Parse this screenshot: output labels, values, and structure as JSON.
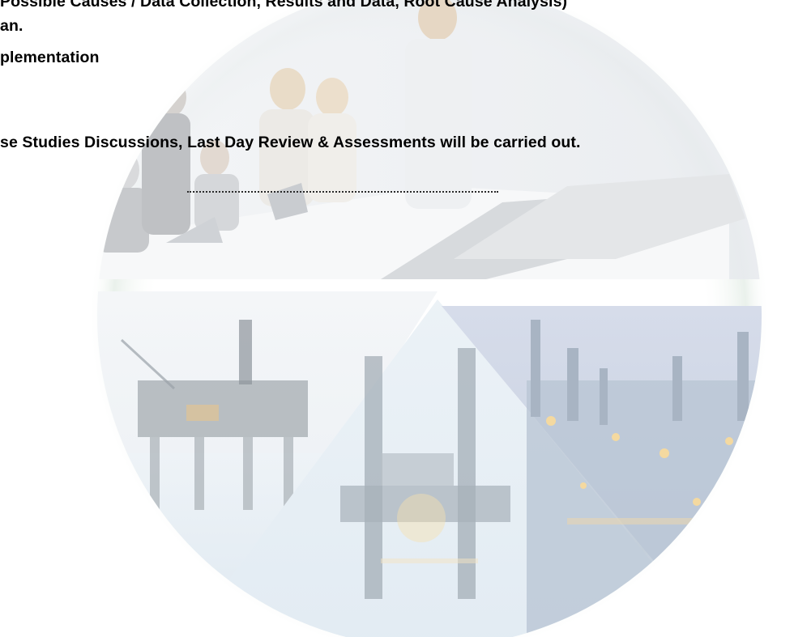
{
  "document": {
    "lines": [
      "Possible Causes / Data Collection, Results and Data, Root Cause Analysis)",
      "an.",
      "plementation",
      "se Studies Discussions, Last Day Review & Assessments will be carried out."
    ]
  },
  "background": {
    "top_image": "business-meeting-photo",
    "bottom_images": [
      "offshore-platform-photo",
      "jackup-rig-photo",
      "refinery-night-photo"
    ],
    "colors": {
      "ring": "#e7efe9",
      "meeting_wall": "#eef1f4",
      "table": "#f6f7f8",
      "sea": "#eaf1f6",
      "refinery_sky": "#c9d4e3",
      "lights": "#f4d9a0"
    }
  }
}
